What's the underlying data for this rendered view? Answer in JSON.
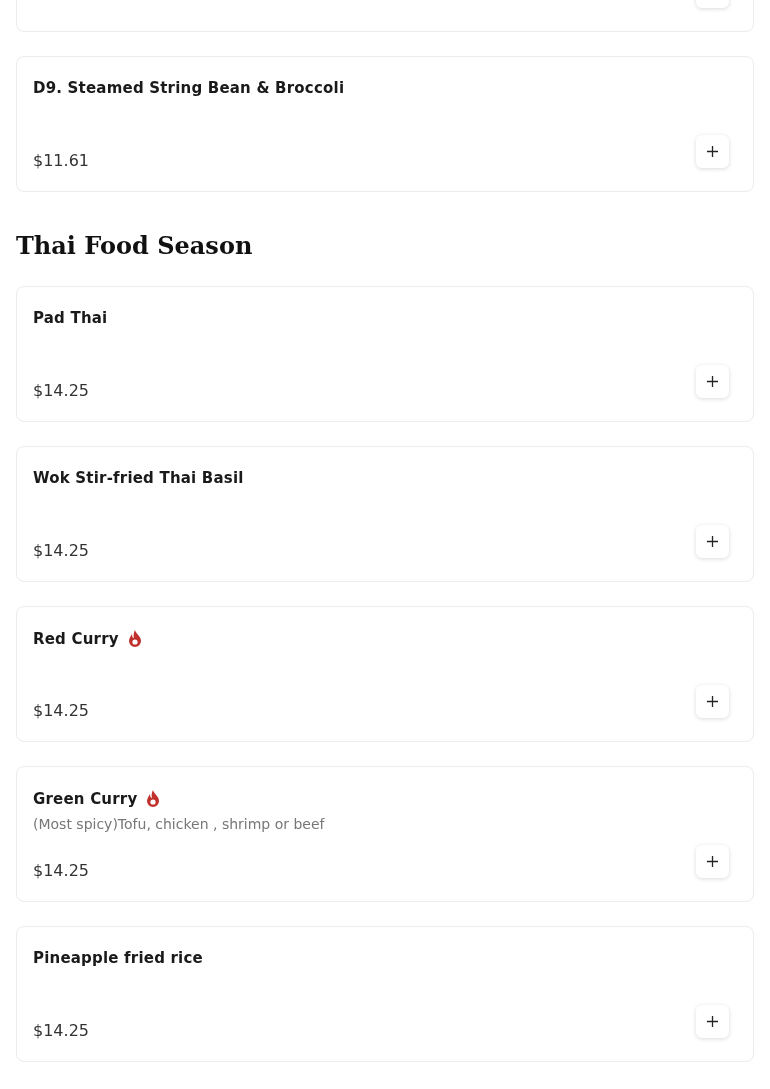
{
  "top_items": [
    {
      "kind": "partial"
    },
    {
      "name": "D9. Steamed String Bean & Broccoli",
      "price": "$11.61",
      "spicy": false
    }
  ],
  "sections": [
    {
      "title": "Thai Food Season",
      "items": [
        {
          "name": "Pad Thai",
          "price": "$14.25",
          "spicy": false
        },
        {
          "name": "Wok Stir-fried Thai Basil",
          "price": "$14.25",
          "spicy": false
        },
        {
          "name": "Red Curry",
          "price": "$14.25",
          "spicy": true
        },
        {
          "name": "Green Curry",
          "description": "(Most spicy)Tofu, chicken , shrimp or beef",
          "price": "$14.25",
          "spicy": true
        },
        {
          "name": "Pineapple fried rice",
          "price": "$14.25",
          "spicy": false
        }
      ]
    }
  ]
}
